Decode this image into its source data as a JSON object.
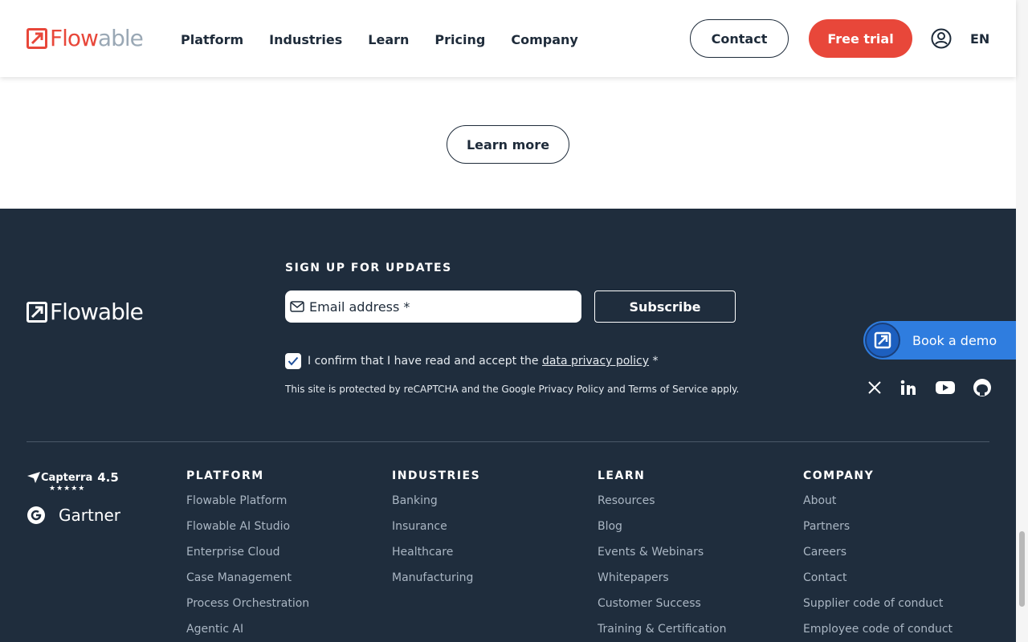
{
  "header": {
    "logo_flow": "Flow",
    "logo_able": "able",
    "nav": [
      "Platform",
      "Industries",
      "Learn",
      "Pricing",
      "Company"
    ],
    "contact_label": "Contact",
    "trial_label": "Free trial",
    "lang": "EN"
  },
  "main": {
    "learn_more_label": "Learn more"
  },
  "footer": {
    "logo_text": "Flowable",
    "signup_heading": "SIGN UP FOR UPDATES",
    "email_placeholder": "Email address *",
    "subscribe_label": "Subscribe",
    "consent_prefix": "I confirm that I have read and accept the ",
    "consent_link": "data privacy policy",
    "consent_suffix": " *",
    "recaptcha": "This site is protected by reCAPTCHA and the Google Privacy Policy and Terms of Service apply.",
    "book_demo": "Book a demo",
    "socials": [
      "x-icon",
      "linkedin-icon",
      "youtube-icon",
      "github-icon"
    ],
    "capterra_name": "Capterra",
    "capterra_rating": "4.5",
    "gartner_name": "Gartner",
    "columns": [
      {
        "heading": "PLATFORM",
        "links": [
          "Flowable Platform",
          "Flowable AI Studio",
          "Enterprise Cloud",
          "Case Management",
          "Process Orchestration",
          "Agentic AI"
        ]
      },
      {
        "heading": "INDUSTRIES",
        "links": [
          "Banking",
          "Insurance",
          "Healthcare",
          "Manufacturing"
        ]
      },
      {
        "heading": "LEARN",
        "links": [
          "Resources",
          "Blog",
          "Events & Webinars",
          "Whitepapers",
          "Customer Success",
          "Training & Certification"
        ]
      },
      {
        "heading": "COMPANY",
        "links": [
          "About",
          "Partners",
          "Careers",
          "Contact",
          "Supplier code of conduct",
          "Employee code of conduct"
        ]
      }
    ]
  },
  "colors": {
    "brand_red": "#e8473a",
    "footer_bg": "#1f2d3d",
    "demo_blue": "#2f7ddf"
  }
}
